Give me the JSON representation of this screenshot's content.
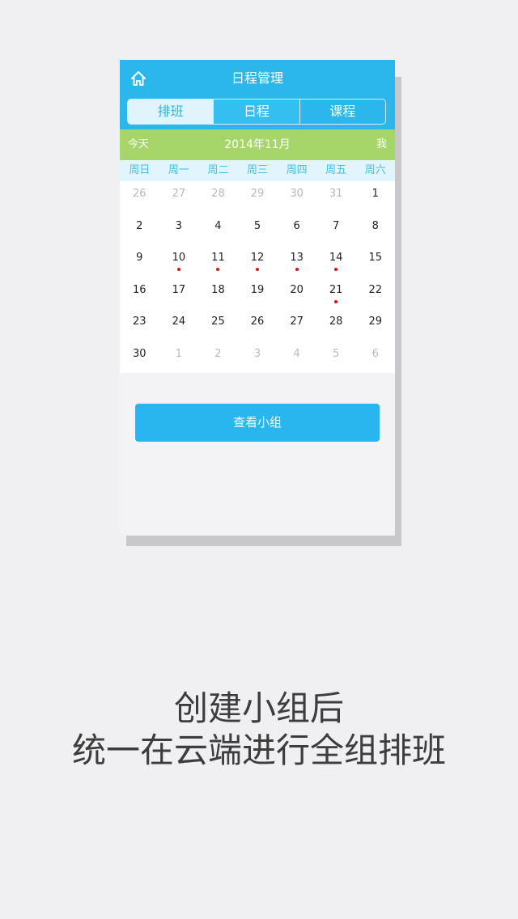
{
  "header": {
    "title": "日程管理",
    "home_icon": "home-icon"
  },
  "tabs": [
    {
      "label": "排班",
      "state": "active"
    },
    {
      "label": "日程",
      "state": "middle"
    },
    {
      "label": "课程",
      "state": ""
    }
  ],
  "month_bar": {
    "today": "今天",
    "month": "2014年11月",
    "me": "我"
  },
  "weekdays": [
    "周日",
    "周一",
    "周二",
    "周三",
    "周四",
    "周五",
    "周六"
  ],
  "calendar": {
    "weeks": [
      [
        {
          "d": "26",
          "other": true
        },
        {
          "d": "27",
          "other": true
        },
        {
          "d": "28",
          "other": true
        },
        {
          "d": "29",
          "other": true
        },
        {
          "d": "30",
          "other": true
        },
        {
          "d": "31",
          "other": true
        },
        {
          "d": "1"
        }
      ],
      [
        {
          "d": "2"
        },
        {
          "d": "3"
        },
        {
          "d": "4"
        },
        {
          "d": "5"
        },
        {
          "d": "6"
        },
        {
          "d": "7"
        },
        {
          "d": "8"
        }
      ],
      [
        {
          "d": "9"
        },
        {
          "d": "10",
          "dot": true
        },
        {
          "d": "11",
          "dot": true
        },
        {
          "d": "12",
          "dot": true
        },
        {
          "d": "13",
          "dot": true
        },
        {
          "d": "14",
          "dot": true
        },
        {
          "d": "15"
        }
      ],
      [
        {
          "d": "16"
        },
        {
          "d": "17"
        },
        {
          "d": "18"
        },
        {
          "d": "19"
        },
        {
          "d": "20"
        },
        {
          "d": "21",
          "dot": true
        },
        {
          "d": "22"
        }
      ],
      [
        {
          "d": "23"
        },
        {
          "d": "24"
        },
        {
          "d": "25"
        },
        {
          "d": "26"
        },
        {
          "d": "27"
        },
        {
          "d": "28"
        },
        {
          "d": "29"
        }
      ],
      [
        {
          "d": "30"
        },
        {
          "d": "1",
          "other": true
        },
        {
          "d": "2",
          "other": true
        },
        {
          "d": "3",
          "other": true
        },
        {
          "d": "4",
          "other": true
        },
        {
          "d": "5",
          "other": true
        },
        {
          "d": "6",
          "other": true
        }
      ]
    ]
  },
  "button": {
    "label": "查看小组"
  },
  "caption": {
    "line1": "创建小组后",
    "line2": "统一在云端进行全组排班"
  },
  "colors": {
    "header": "#2bb6ec",
    "month_bar": "#a6d66a",
    "event_dot": "#e01010"
  }
}
